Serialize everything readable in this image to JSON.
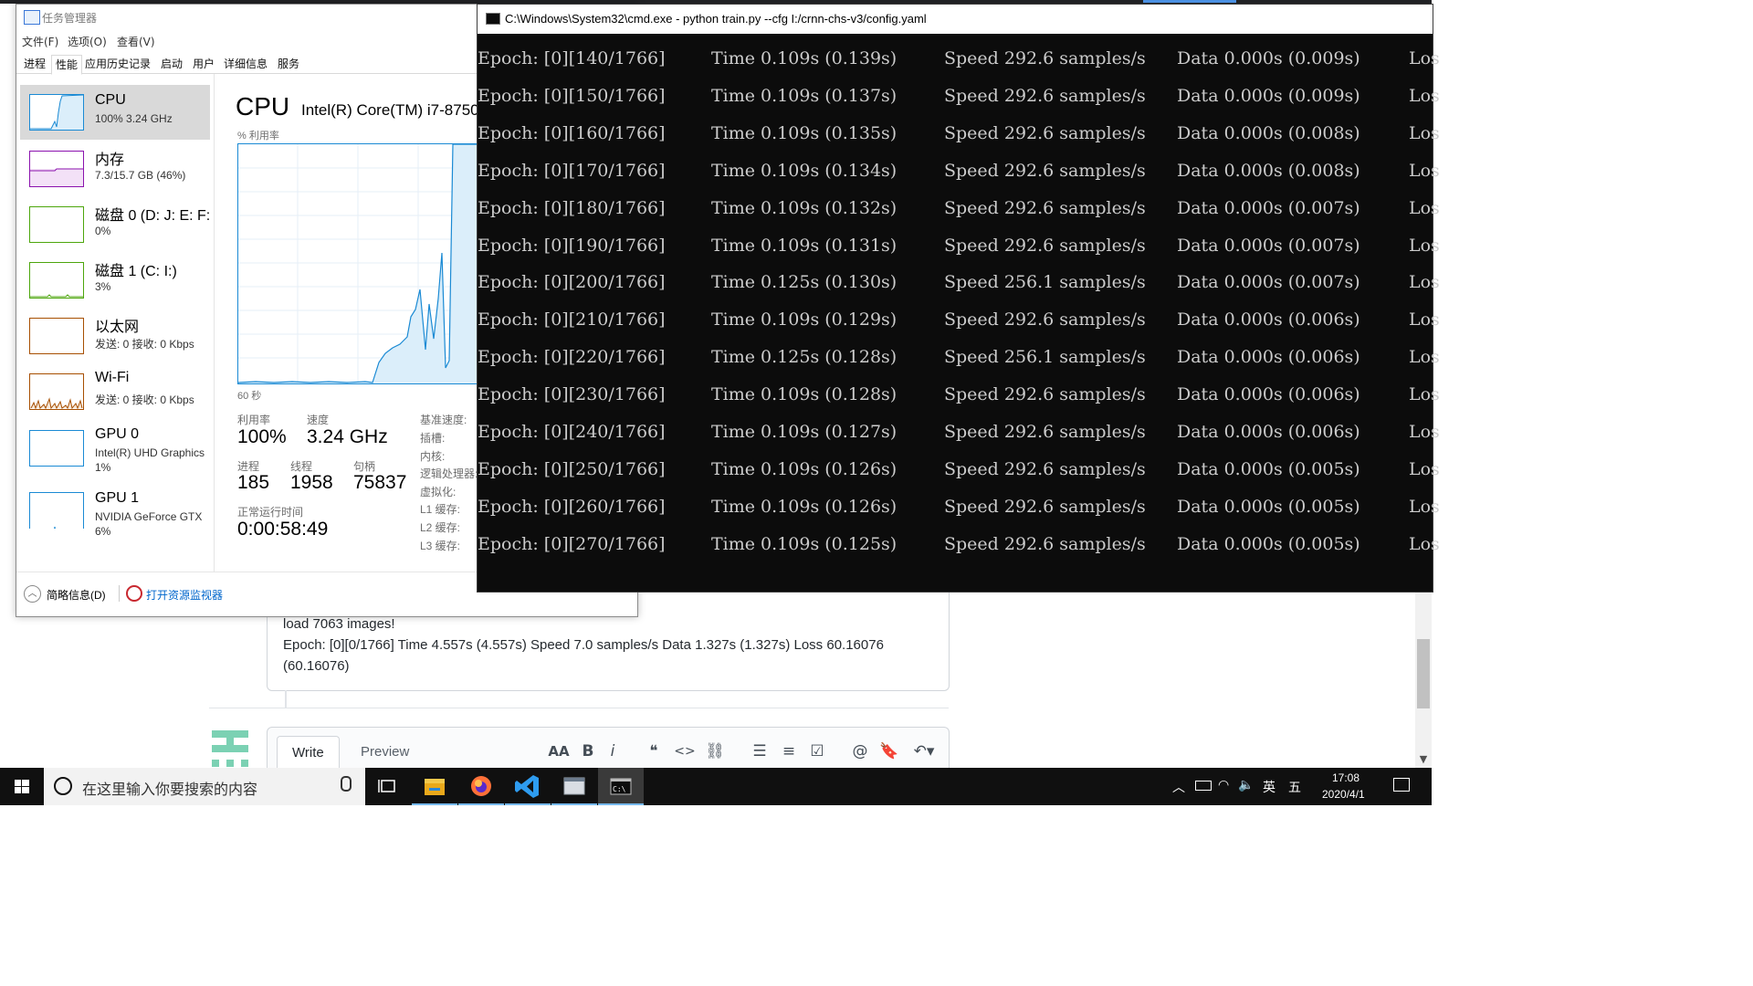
{
  "browser": {
    "comment": {
      "line1": "load 7063 images!",
      "line2": "Epoch: [0][0/1766] Time 4.557s (4.557s) Speed 7.0 samples/s Data 1.327s (1.327s) Loss 60.16076",
      "line3": "(60.16076)"
    },
    "editor": {
      "write_tab": "Write",
      "preview_tab": "Preview",
      "toolbar": {
        "heading": "AA",
        "bold": "B",
        "italic": "i",
        "quote": "❝",
        "code": "<>",
        "link": "⛓",
        "bulleted_list": "☰",
        "numbered_list": "≡",
        "task_list": "☑",
        "mention": "@",
        "reference": "🔖",
        "reply": "↶▾"
      }
    }
  },
  "task_manager": {
    "title": "任务管理器",
    "menu": [
      "文件(F)",
      "选项(O)",
      "查看(V)"
    ],
    "tabs": [
      "进程",
      "性能",
      "应用历史记录",
      "启动",
      "用户",
      "详细信息",
      "服务"
    ],
    "active_tab": "性能",
    "resources": [
      {
        "name": "CPU",
        "sub": "100% 3.24 GHz",
        "color": "#1a8ad4",
        "selected": true
      },
      {
        "name": "内存",
        "sub": "7.3/15.7 GB (46%)",
        "color": "#8b12ae"
      },
      {
        "name": "磁盘 0 (D: J: E: F:",
        "sub": "0%",
        "color": "#4da60c"
      },
      {
        "name": "磁盘 1 (C: I:)",
        "sub": "3%",
        "color": "#4da60c"
      },
      {
        "name": "以太网",
        "sub": "发送: 0 接收: 0 Kbps",
        "color": "#a74f01"
      },
      {
        "name": "Wi-Fi",
        "sub": "发送: 0 接收: 0 Kbps",
        "color": "#a74f01"
      },
      {
        "name": "GPU 0",
        "sub": "Intel(R) UHD Graphics",
        "sub2": "1%",
        "color": "#1a8ad4"
      },
      {
        "name": "GPU 1",
        "sub": "NVIDIA GeForce GTX",
        "sub2": "6%",
        "color": "#1a8ad4"
      }
    ],
    "detail": {
      "title": "CPU",
      "model": "Intel(R) Core(TM) i7-8750",
      "graph_label": "% 利用率",
      "graph_time": "60 秒",
      "utilization_label": "利用率",
      "utilization": "100%",
      "speed_label": "速度",
      "speed": "3.24 GHz",
      "processes_label": "进程",
      "processes": "185",
      "threads_label": "线程",
      "threads": "1958",
      "handles_label": "句柄",
      "handles": "75837",
      "uptime_label": "正常运行时间",
      "uptime": "0:00:58:49",
      "side_labels": [
        "基准速度:",
        "插槽:",
        "内核:",
        "逻辑处理器:",
        "虚拟化:",
        "L1 缓存:",
        "L2 缓存:",
        "L3 缓存:"
      ]
    },
    "footer": {
      "brief": "简略信息(D)",
      "resource_monitor": "打开资源监视器"
    }
  },
  "cmd": {
    "title": "C:\\Windows\\System32\\cmd.exe - python  train.py --cfg I:/crnn-chs-v3/config.yaml",
    "lines": [
      {
        "epoch": "Epoch: [0][140/1766]",
        "time": "Time 0.109s (0.139s)",
        "speed": "Speed 292.6 samples/s",
        "data": "Data 0.000s (0.009s)",
        "loss": "Los"
      },
      {
        "epoch": "Epoch: [0][150/1766]",
        "time": "Time 0.109s (0.137s)",
        "speed": "Speed 292.6 samples/s",
        "data": "Data 0.000s (0.009s)",
        "loss": "Los"
      },
      {
        "epoch": "Epoch: [0][160/1766]",
        "time": "Time 0.109s (0.135s)",
        "speed": "Speed 292.6 samples/s",
        "data": "Data 0.000s (0.008s)",
        "loss": "Los"
      },
      {
        "epoch": "Epoch: [0][170/1766]",
        "time": "Time 0.109s (0.134s)",
        "speed": "Speed 292.6 samples/s",
        "data": "Data 0.000s (0.008s)",
        "loss": "Los"
      },
      {
        "epoch": "Epoch: [0][180/1766]",
        "time": "Time 0.109s (0.132s)",
        "speed": "Speed 292.6 samples/s",
        "data": "Data 0.000s (0.007s)",
        "loss": "Los"
      },
      {
        "epoch": "Epoch: [0][190/1766]",
        "time": "Time 0.109s (0.131s)",
        "speed": "Speed 292.6 samples/s",
        "data": "Data 0.000s (0.007s)",
        "loss": "Los"
      },
      {
        "epoch": "Epoch: [0][200/1766]",
        "time": "Time 0.125s (0.130s)",
        "speed": "Speed 256.1 samples/s",
        "data": "Data 0.000s (0.007s)",
        "loss": "Los"
      },
      {
        "epoch": "Epoch: [0][210/1766]",
        "time": "Time 0.109s (0.129s)",
        "speed": "Speed 292.6 samples/s",
        "data": "Data 0.000s (0.006s)",
        "loss": "Los"
      },
      {
        "epoch": "Epoch: [0][220/1766]",
        "time": "Time 0.125s (0.128s)",
        "speed": "Speed 256.1 samples/s",
        "data": "Data 0.000s (0.006s)",
        "loss": "Los"
      },
      {
        "epoch": "Epoch: [0][230/1766]",
        "time": "Time 0.109s (0.128s)",
        "speed": "Speed 292.6 samples/s",
        "data": "Data 0.000s (0.006s)",
        "loss": "Los"
      },
      {
        "epoch": "Epoch: [0][240/1766]",
        "time": "Time 0.109s (0.127s)",
        "speed": "Speed 292.6 samples/s",
        "data": "Data 0.000s (0.006s)",
        "loss": "Los"
      },
      {
        "epoch": "Epoch: [0][250/1766]",
        "time": "Time 0.109s (0.126s)",
        "speed": "Speed 292.6 samples/s",
        "data": "Data 0.000s (0.005s)",
        "loss": "Los"
      },
      {
        "epoch": "Epoch: [0][260/1766]",
        "time": "Time 0.109s (0.126s)",
        "speed": "Speed 292.6 samples/s",
        "data": "Data 0.000s (0.005s)",
        "loss": "Los"
      },
      {
        "epoch": "Epoch: [0][270/1766]",
        "time": "Time 0.109s (0.125s)",
        "speed": "Speed 292.6 samples/s",
        "data": "Data 0.000s (0.005s)",
        "loss": "Los"
      }
    ]
  },
  "taskbar": {
    "search_placeholder": "在这里输入你要搜索的内容",
    "apps": [
      "task-view",
      "file-explorer",
      "firefox",
      "vscode",
      "window-app",
      "cmd"
    ],
    "tray": {
      "ime_lang": "英",
      "ime_mode": "五",
      "time": "17:08",
      "date": "2020/4/1"
    }
  }
}
